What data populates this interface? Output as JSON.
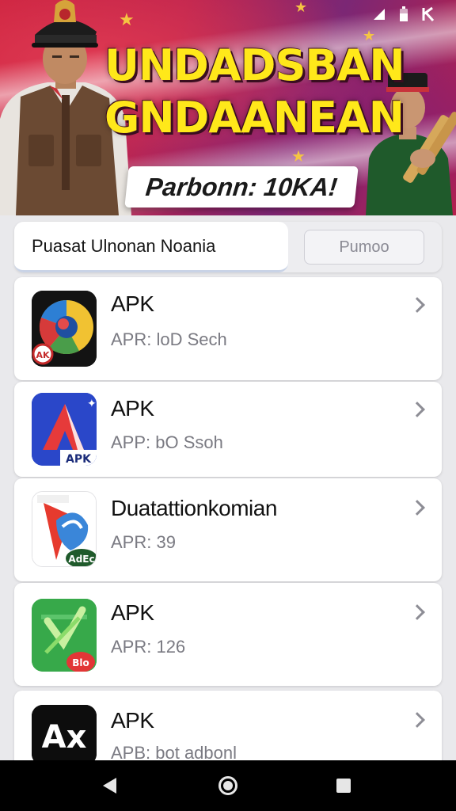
{
  "banner": {
    "headline_line1": "UNDADSBAN",
    "headline_line2": "GNDAANEAN",
    "subline": "Parbonn: 10KA!"
  },
  "colors": {
    "banner_red": "#c81d3a",
    "banner_purple": "#7b2775",
    "headline_yellow": "#ffe81a",
    "list_background": "#e9e9ec"
  },
  "search": {
    "value": "Puasat Ulnonan Noania",
    "button_label": "Pumoo"
  },
  "apps": [
    {
      "title": "APK",
      "meta": "APR: loD Sech",
      "icon": "color-wheel-icon"
    },
    {
      "title": "APK",
      "meta": "APP: bO Ssoh",
      "icon": "red-a-logo-icon"
    },
    {
      "title": "Duatattionkomian",
      "meta": "APR: 39",
      "icon": "map-pin-icon"
    },
    {
      "title": "APK",
      "meta": "APR: 126",
      "icon": "green-check-icon"
    },
    {
      "title": "APK",
      "meta": "APB: bot adbonl",
      "icon": "ax-logo-icon"
    }
  ],
  "badges": {
    "app1_badge": "AK",
    "app2_badge": "APK",
    "app3_badge": "AdEc",
    "app4_badge": "Blo",
    "app5_logo": "Ax"
  },
  "navigation": {
    "back": "back-icon",
    "home": "home-icon",
    "recents": "recents-icon"
  }
}
